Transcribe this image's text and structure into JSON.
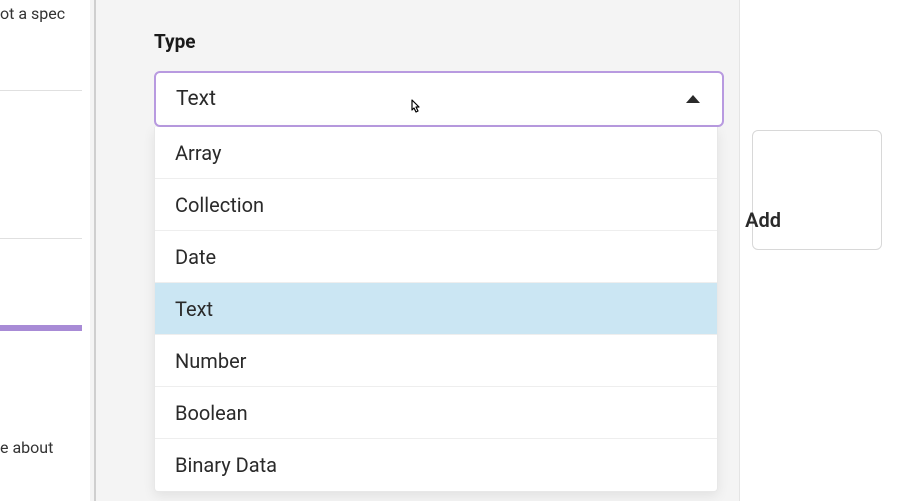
{
  "left_panel": {
    "text_fragment_1": "ot a spec",
    "text_fragment_2": "e about"
  },
  "form": {
    "type_label": "Type",
    "selected_value": "Text",
    "options": [
      "Array",
      "Collection",
      "Date",
      "Text",
      "Number",
      "Boolean",
      "Binary Data"
    ],
    "highlighted_option": "Text"
  },
  "actions": {
    "add_label": "Add"
  }
}
